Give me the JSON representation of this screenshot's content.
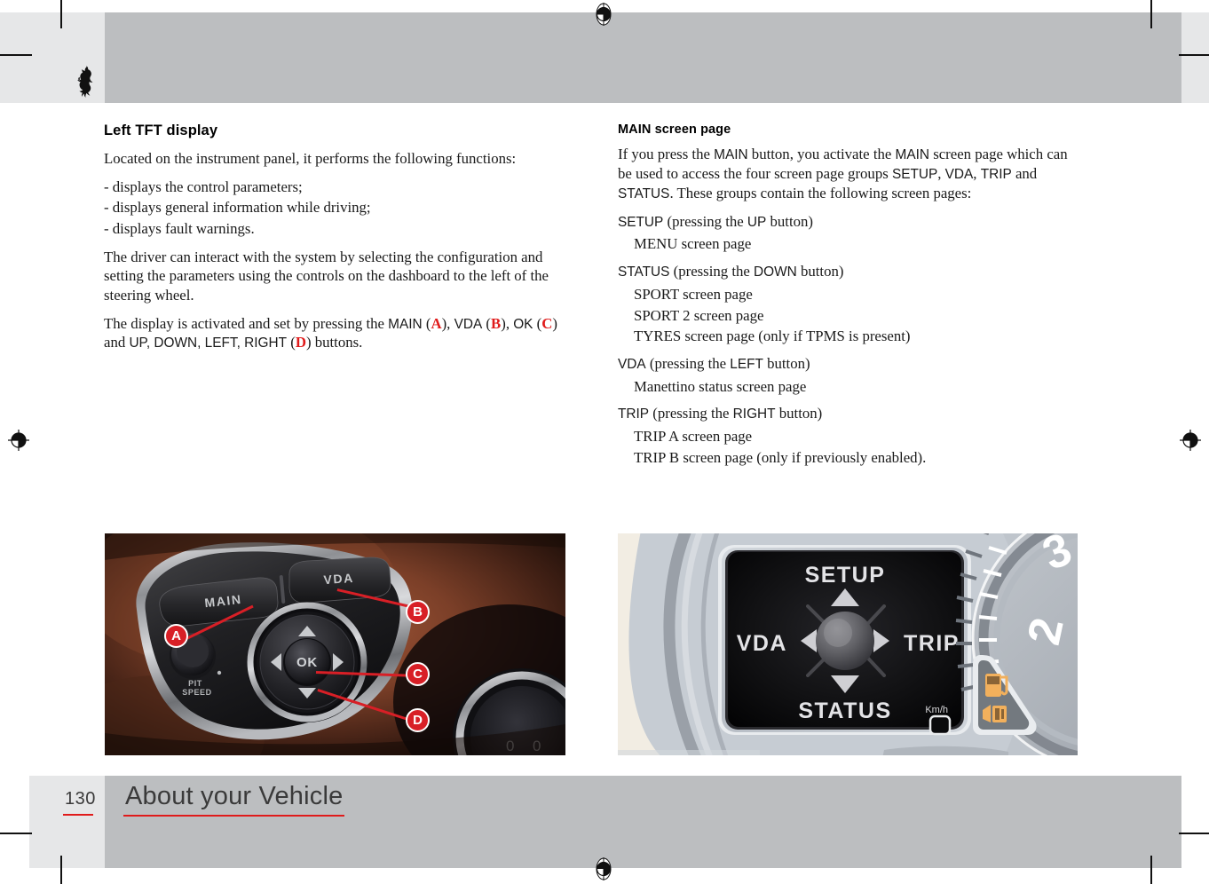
{
  "header": {
    "logo_icon": "ferrari-prancing-horse-logo"
  },
  "left_column": {
    "heading": "Left TFT display",
    "paragraphs": [
      "Located on the instrument panel, it performs the following functions:",
      "- displays the control parameters;",
      "- displays general information while driving;",
      "- displays fault warnings.",
      "The driver can interact with the system by selecting the configuration and setting the parameters using the controls on the dashboard to the left of the steering wheel."
    ],
    "final_sentence": {
      "part1": "The display is activated and set by pressing the ",
      "btn1": "MAIN",
      "ref1": "A",
      "part2": ", ",
      "btn2": "VDA",
      "ref2": "B",
      "part3": ", ",
      "btn3": "OK",
      "ref3": "C",
      "part4": " and ",
      "btn4": "UP, DOWN, LEFT, RIGHT",
      "ref4": "D",
      "part5": ") buttons."
    }
  },
  "right_column": {
    "heading": "MAIN screen page",
    "intro": {
      "t1": "If you press the ",
      "b1": "MAIN",
      "t2": " button, you activate the ",
      "b2": "MAIN",
      "t3": " screen page which can be used to access the four screen page groups ",
      "b3": "SETUP",
      "t4": ", ",
      "b4": "VDA",
      "t5": ", ",
      "b5": "TRIP",
      "t6": " and ",
      "b6": "STATUS",
      "t7": ". These groups contain the following screen pages:"
    },
    "groups": [
      {
        "name": "SETUP",
        "press_pre": " (pressing the ",
        "button": "UP",
        "press_post": " button)",
        "pages": [
          "MENU screen page"
        ]
      },
      {
        "name": "STATUS",
        "press_pre": " (pressing the ",
        "button": "DOWN",
        "press_post": " button)",
        "pages": [
          "SPORT screen page",
          "SPORT 2 screen page",
          "TYRES screen page (only if TPMS is present)"
        ]
      },
      {
        "name": "VDA",
        "press_pre": " (pressing the ",
        "button": "LEFT",
        "press_post": " button)",
        "pages": [
          "Manettino status screen page"
        ]
      },
      {
        "name": "TRIP",
        "press_pre": " (pressing the ",
        "button": "RIGHT",
        "press_post": " button)",
        "pages": [
          "TRIP A screen page",
          "TRIP B screen page (only if previously enabled)."
        ]
      }
    ]
  },
  "figure_left": {
    "name": "steering-wheel-controls-photo",
    "labels": {
      "main": "MAIN",
      "vda": "VDA",
      "ok": "OK",
      "pit": "PIT",
      "speed": "SPEED"
    },
    "callouts": [
      "A",
      "B",
      "C",
      "D"
    ],
    "callout_color": "#d81f26"
  },
  "figure_right": {
    "name": "tft-main-screen-page-illustration",
    "screen": {
      "top": "SETUP",
      "left": "VDA",
      "right": "TRIP",
      "bottom": "STATUS",
      "unit": "Km/h"
    },
    "gauge_numbers": [
      "3",
      "2"
    ],
    "tell_tales": [
      "fuel-pump-icon",
      "fuel-cap-warning-icon"
    ],
    "background_color": "#f2ede3"
  },
  "footer": {
    "page_number": "130",
    "title": "About your Vehicle",
    "rule_color": "#e01b1b"
  }
}
